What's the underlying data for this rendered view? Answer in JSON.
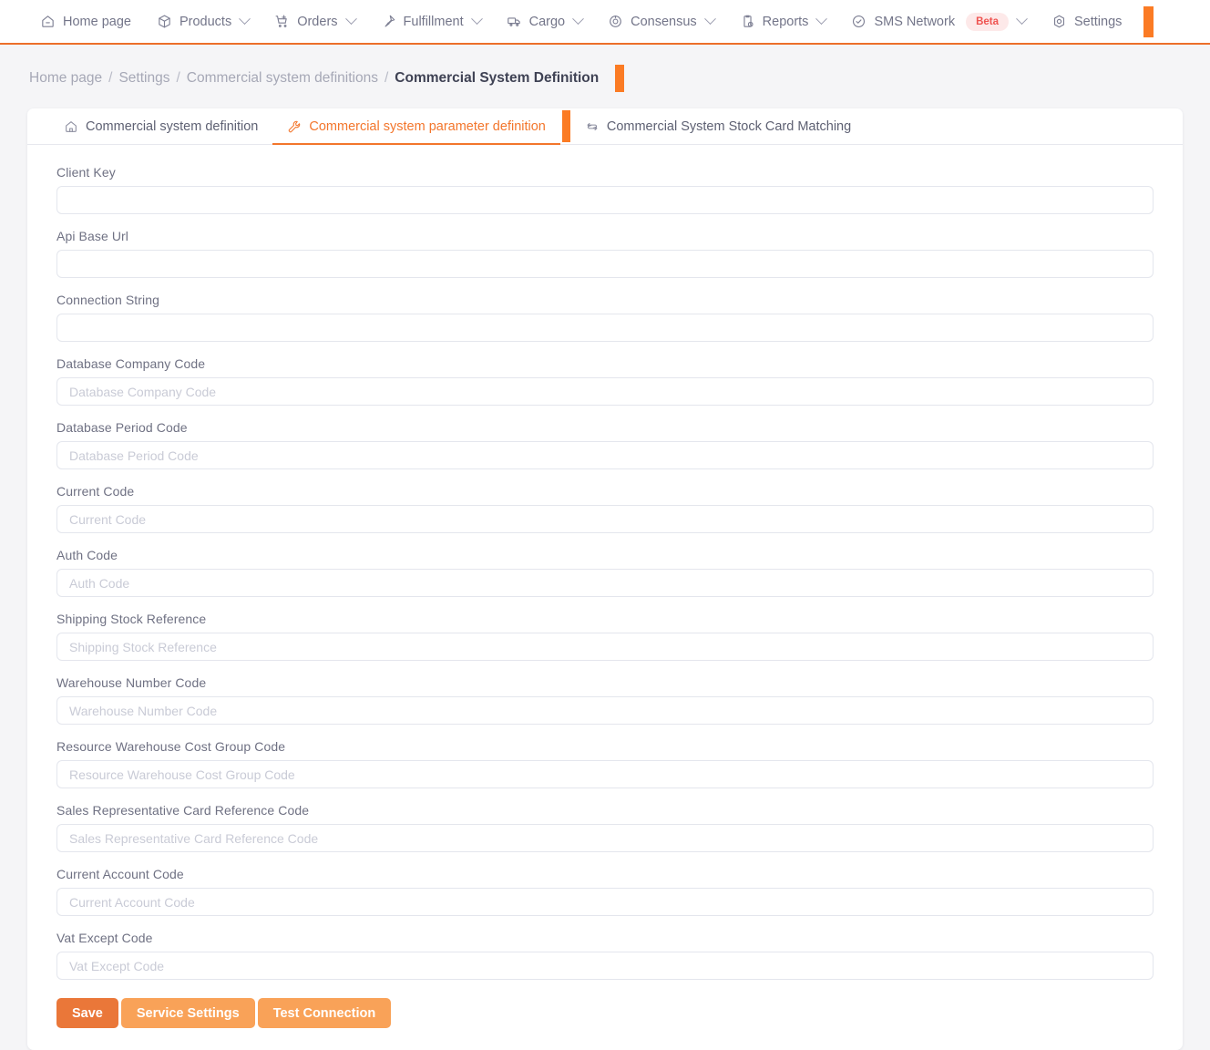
{
  "topnav": {
    "items": [
      {
        "label": "Home page",
        "icon": "home-icon",
        "caret": false,
        "badge": null
      },
      {
        "label": "Products",
        "icon": "box-icon",
        "caret": true,
        "badge": null
      },
      {
        "label": "Orders",
        "icon": "cart-plus-icon",
        "caret": true,
        "badge": null
      },
      {
        "label": "Fulfillment",
        "icon": "pin-icon",
        "caret": true,
        "badge": null
      },
      {
        "label": "Cargo",
        "icon": "truck-icon",
        "caret": true,
        "badge": null
      },
      {
        "label": "Consensus",
        "icon": "target-icon",
        "caret": true,
        "badge": null
      },
      {
        "label": "Reports",
        "icon": "clipboard-clock-icon",
        "caret": true,
        "badge": null
      },
      {
        "label": "SMS Network",
        "icon": "check-circle-icon",
        "caret": true,
        "badge": "Beta"
      },
      {
        "label": "Settings",
        "icon": "gear-hex-icon",
        "caret": false,
        "badge": null
      }
    ],
    "marker_color": "#fb7b24",
    "underline_color": "#ec6f2a",
    "badge_bg": "#fde9e9",
    "badge_color": "#ef5350"
  },
  "breadcrumb": {
    "items": [
      {
        "label": "Home page",
        "active": false
      },
      {
        "label": "Settings",
        "active": false
      },
      {
        "label": "Commercial system definitions",
        "active": false
      },
      {
        "label": "Commercial System Definition",
        "active": true
      }
    ],
    "separator": "/",
    "marker_color": "#fb7b24"
  },
  "tabs": [
    {
      "label": "Commercial system definition",
      "icon": "home-outline-icon",
      "active": false
    },
    {
      "label": "Commercial system parameter definition",
      "icon": "wrench-icon",
      "active": true
    },
    {
      "label": "Commercial System Stock Card Matching",
      "icon": "sync-arrows-icon",
      "active": false
    }
  ],
  "form": {
    "fields": [
      {
        "label": "Client Key",
        "placeholder": "",
        "value": ""
      },
      {
        "label": "Api Base Url",
        "placeholder": "",
        "value": ""
      },
      {
        "label": "Connection String",
        "placeholder": "",
        "value": ""
      },
      {
        "label": "Database Company Code",
        "placeholder": "Database Company Code",
        "value": ""
      },
      {
        "label": "Database Period Code",
        "placeholder": "Database Period Code",
        "value": ""
      },
      {
        "label": "Current Code",
        "placeholder": "Current Code",
        "value": ""
      },
      {
        "label": "Auth Code",
        "placeholder": "Auth Code",
        "value": ""
      },
      {
        "label": "Shipping Stock Reference",
        "placeholder": "Shipping Stock Reference",
        "value": ""
      },
      {
        "label": "Warehouse Number Code",
        "placeholder": "Warehouse Number Code",
        "value": ""
      },
      {
        "label": "Resource Warehouse Cost Group Code",
        "placeholder": "Resource Warehouse Cost Group Code",
        "value": ""
      },
      {
        "label": "Sales Representative Card Reference Code",
        "placeholder": "Sales Representative Card Reference Code",
        "value": ""
      },
      {
        "label": "Current Account Code",
        "placeholder": "Current Account Code",
        "value": ""
      },
      {
        "label": "Vat Except Code",
        "placeholder": "Vat Except Code",
        "value": ""
      }
    ]
  },
  "buttons": [
    {
      "label": "Save",
      "style": "primary",
      "color": "#ea7739"
    },
    {
      "label": "Service Settings",
      "style": "secondary",
      "color": "#f9a258"
    },
    {
      "label": "Test Connection",
      "style": "secondary",
      "color": "#f9a258"
    }
  ]
}
